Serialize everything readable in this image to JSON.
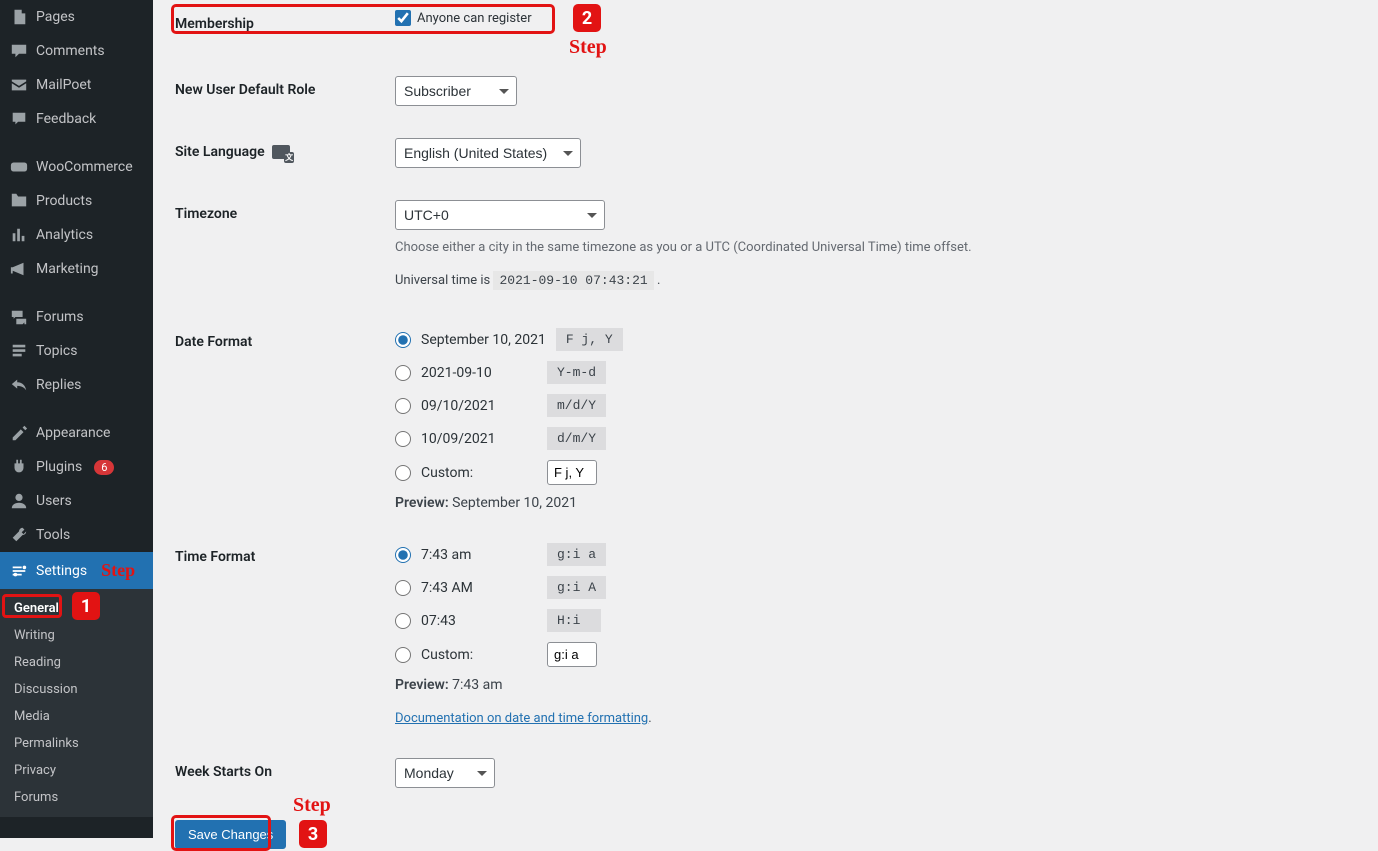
{
  "sidebar": {
    "items": [
      {
        "label": "Pages",
        "icon": "pages"
      },
      {
        "label": "Comments",
        "icon": "comment"
      },
      {
        "label": "MailPoet",
        "icon": "mailpoet"
      },
      {
        "label": "Feedback",
        "icon": "feedback"
      }
    ],
    "items2": [
      {
        "label": "WooCommerce",
        "icon": "woo"
      },
      {
        "label": "Products",
        "icon": "products"
      },
      {
        "label": "Analytics",
        "icon": "analytics"
      },
      {
        "label": "Marketing",
        "icon": "marketing"
      }
    ],
    "items3": [
      {
        "label": "Forums",
        "icon": "forums"
      },
      {
        "label": "Topics",
        "icon": "topics"
      },
      {
        "label": "Replies",
        "icon": "replies"
      }
    ],
    "items4": [
      {
        "label": "Appearance",
        "icon": "appearance"
      },
      {
        "label": "Plugins",
        "icon": "plugins",
        "badge": "6"
      },
      {
        "label": "Users",
        "icon": "users"
      },
      {
        "label": "Tools",
        "icon": "tools"
      },
      {
        "label": "Settings",
        "icon": "settings",
        "active": true
      }
    ],
    "submenu": [
      "General",
      "Writing",
      "Reading",
      "Discussion",
      "Media",
      "Permalinks",
      "Privacy",
      "Forums"
    ]
  },
  "settings": {
    "membership_label": "Membership",
    "membership_checkbox": "Anyone can register",
    "new_user_role_label": "New User Default Role",
    "new_user_role_value": "Subscriber",
    "site_language_label": "Site Language",
    "site_language_value": "English (United States)",
    "timezone_label": "Timezone",
    "timezone_value": "UTC+0",
    "timezone_help": "Choose either a city in the same timezone as you or a UTC (Coordinated Universal Time) time offset.",
    "universal_time_prefix": "Universal time is ",
    "universal_time_value": "2021-09-10 07:43:21",
    "date_format_label": "Date Format",
    "date_formats": [
      {
        "label": "September 10, 2021",
        "code": "F j, Y",
        "checked": true
      },
      {
        "label": "2021-09-10",
        "code": "Y-m-d"
      },
      {
        "label": "09/10/2021",
        "code": "m/d/Y"
      },
      {
        "label": "10/09/2021",
        "code": "d/m/Y"
      }
    ],
    "date_custom_label": "Custom:",
    "date_custom_value": "F j, Y",
    "date_preview_label": "Preview:",
    "date_preview_value": "September 10, 2021",
    "time_format_label": "Time Format",
    "time_formats": [
      {
        "label": "7:43 am",
        "code": "g:i a",
        "checked": true
      },
      {
        "label": "7:43 AM",
        "code": "g:i A"
      },
      {
        "label": "07:43",
        "code": "H:i"
      }
    ],
    "time_custom_label": "Custom:",
    "time_custom_value": "g:i a",
    "time_preview_label": "Preview:",
    "time_preview_value": "7:43 am",
    "doc_link": "Documentation on date and time formatting",
    "week_starts_label": "Week Starts On",
    "week_starts_value": "Monday",
    "save_button": "Save Changes"
  },
  "annotations": {
    "step": "Step",
    "n1": "1",
    "n2": "2",
    "n3": "3"
  }
}
